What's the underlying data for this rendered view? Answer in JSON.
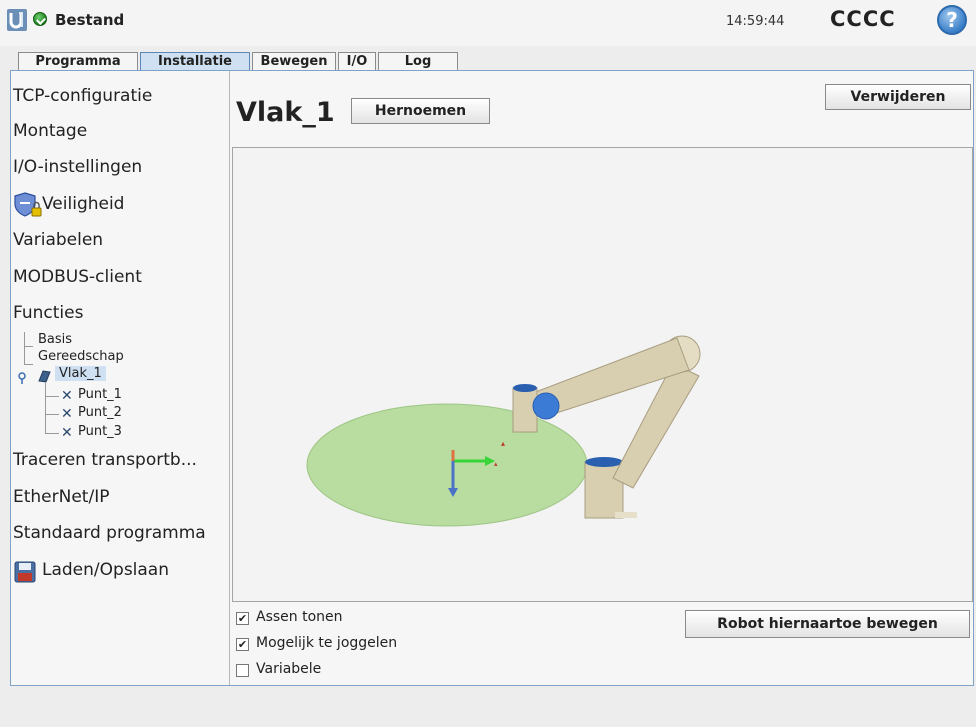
{
  "header": {
    "app_title": "Bestand",
    "clock": "14:59:44",
    "robot_name": "CCCC",
    "help_symbol": "?",
    "logo_icon": "ur-logo-icon",
    "status_icon": "status-ok-icon"
  },
  "tabs": [
    {
      "label": "Programma"
    },
    {
      "label": "Installatie"
    },
    {
      "label": "Bewegen"
    },
    {
      "label": "I/O"
    },
    {
      "label": "Log"
    }
  ],
  "sidebar": {
    "items": [
      {
        "label": "TCP-configuratie"
      },
      {
        "label": "Montage"
      },
      {
        "label": "I/O-instellingen"
      },
      {
        "label": "Veiligheid"
      },
      {
        "label": "Variabelen"
      },
      {
        "label": "MODBUS-client"
      },
      {
        "label": "Functies"
      },
      {
        "label": "Traceren transportb..."
      },
      {
        "label": "EtherNet/IP"
      },
      {
        "label": "Standaard programma"
      },
      {
        "label": "Laden/Opslaan"
      }
    ],
    "tree": [
      {
        "label": "Basis"
      },
      {
        "label": "Gereedschap"
      },
      {
        "label": "Vlak_1"
      },
      {
        "label": "Punt_1"
      },
      {
        "label": "Punt_2"
      },
      {
        "label": "Punt_3"
      }
    ]
  },
  "main": {
    "title": "Vlak_1",
    "rename_label": "Hernoemen",
    "delete_label": "Verwijderen",
    "move_label": "Robot hiernaartoe bewegen"
  },
  "options": [
    {
      "label": "Assen tonen",
      "checked": true
    },
    {
      "label": "Mogelijk te joggelen",
      "checked": true
    },
    {
      "label": "Variabele",
      "checked": false
    }
  ],
  "colors": {
    "accent": "#5b87b8",
    "active_tab": "#cfe0f2",
    "plane": "#b9dca0",
    "robot_body": "#d8ceb0",
    "joint_blue": "#3b7bd6"
  }
}
